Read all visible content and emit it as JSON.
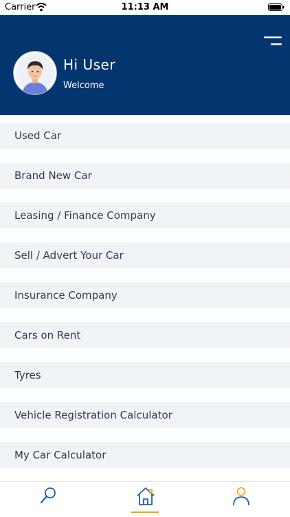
{
  "status_bar": {
    "carrier": "Carrier",
    "time": "11:13 AM"
  },
  "header": {
    "greeting": "Hi User",
    "subtitle": "Welcome",
    "background_color": "#03356e",
    "menu_icon": "hamburger-menu-icon",
    "avatar": "user-avatar"
  },
  "menu": {
    "items": [
      {
        "label": "Used Car"
      },
      {
        "label": "Brand New Car"
      },
      {
        "label": "Leasing / Finance Company"
      },
      {
        "label": "Sell / Advert Your Car"
      },
      {
        "label": "Insurance Company"
      },
      {
        "label": "Cars on Rent"
      },
      {
        "label": "Tyres"
      },
      {
        "label": "Vehicle Registration Calculator"
      },
      {
        "label": "My Car Calculator"
      }
    ]
  },
  "tabbar": {
    "tabs": [
      {
        "icon": "search-icon",
        "selected": false
      },
      {
        "icon": "home-icon",
        "selected": true
      },
      {
        "icon": "profile-icon",
        "selected": false
      }
    ],
    "icon_color": "#1f5fa8",
    "accent_color": "#f0a30a"
  }
}
